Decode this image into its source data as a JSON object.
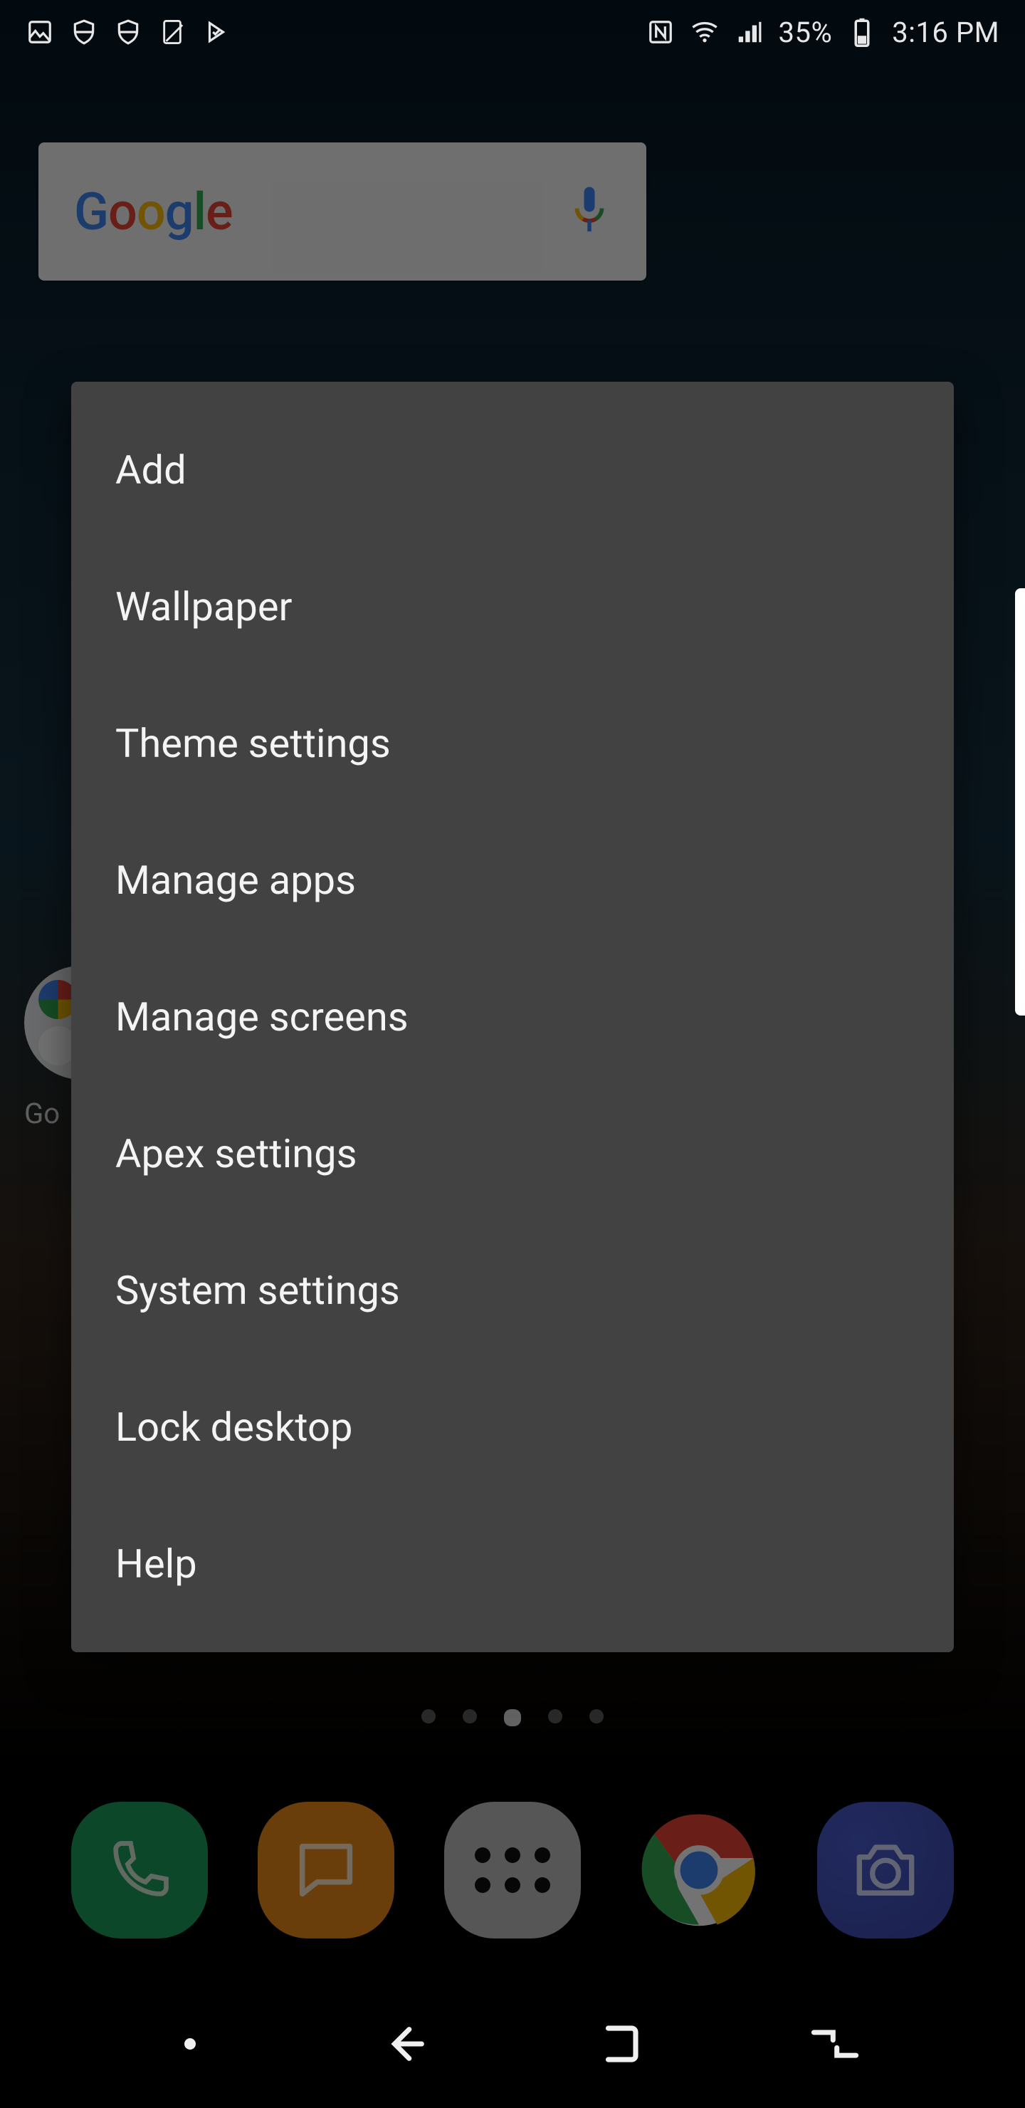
{
  "status": {
    "battery_text": "35%",
    "time_text": "3:16 PM"
  },
  "search_widget": {
    "brand": "Google"
  },
  "home_folder": {
    "label": "Go"
  },
  "context_menu": {
    "items": [
      "Add",
      "Wallpaper",
      "Theme settings",
      "Manage apps",
      "Manage screens",
      "Apex settings",
      "System settings",
      "Lock desktop",
      "Help"
    ]
  },
  "page_indicator": {
    "count": 5,
    "active_index": 2
  },
  "dock": {
    "apps": [
      "Phone",
      "Messages",
      "App drawer",
      "Chrome",
      "Camera"
    ]
  },
  "nav": {
    "keys": [
      "Assistant",
      "Back",
      "Home",
      "Recents"
    ]
  }
}
